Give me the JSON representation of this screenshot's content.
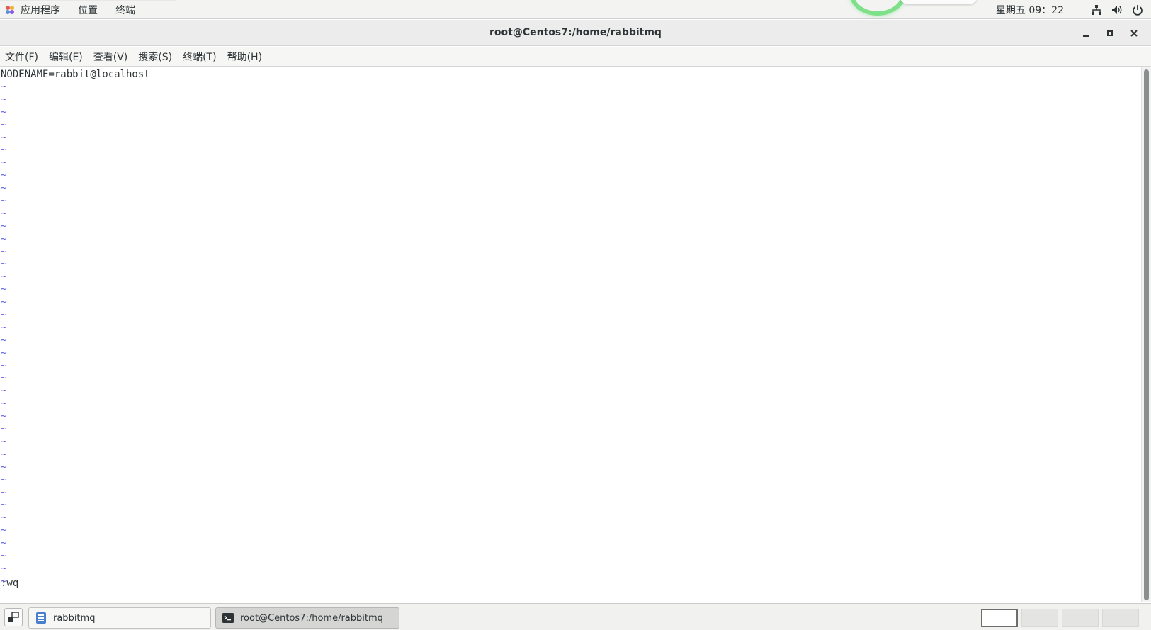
{
  "top_panel": {
    "apps_menu": "应用程序",
    "places_menu": "位置",
    "terminal_menu": "终端",
    "clock": "星期五 09：22",
    "tray_icons": [
      "network-icon",
      "volume-icon",
      "power-icon"
    ]
  },
  "window": {
    "title": "root@Centos7:/home/rabbitmq",
    "controls": [
      "minimize-icon",
      "maximize-icon",
      "close-icon"
    ]
  },
  "menubar": {
    "items": [
      "文件(F)",
      "编辑(E)",
      "查看(V)",
      "搜索(S)",
      "终端(T)",
      "帮助(H)"
    ]
  },
  "terminal": {
    "first_line": "NODENAME=rabbit@localhost",
    "empty_line_marker": "~",
    "command_line": ":wq"
  },
  "taskbar": {
    "tasks": [
      {
        "label": "rabbitmq",
        "icon": "file-manager-icon",
        "active": false
      },
      {
        "label": "root@Centos7:/home/rabbitmq",
        "icon": "terminal-icon",
        "active": true
      }
    ],
    "workspaces_count": 4,
    "current_workspace": 1
  },
  "colors": {
    "vim_tilde": "#5a5ae8",
    "panel_bg": "#f3f3f2",
    "terminal_bg": "#ffffff",
    "text": "#2e3436"
  }
}
